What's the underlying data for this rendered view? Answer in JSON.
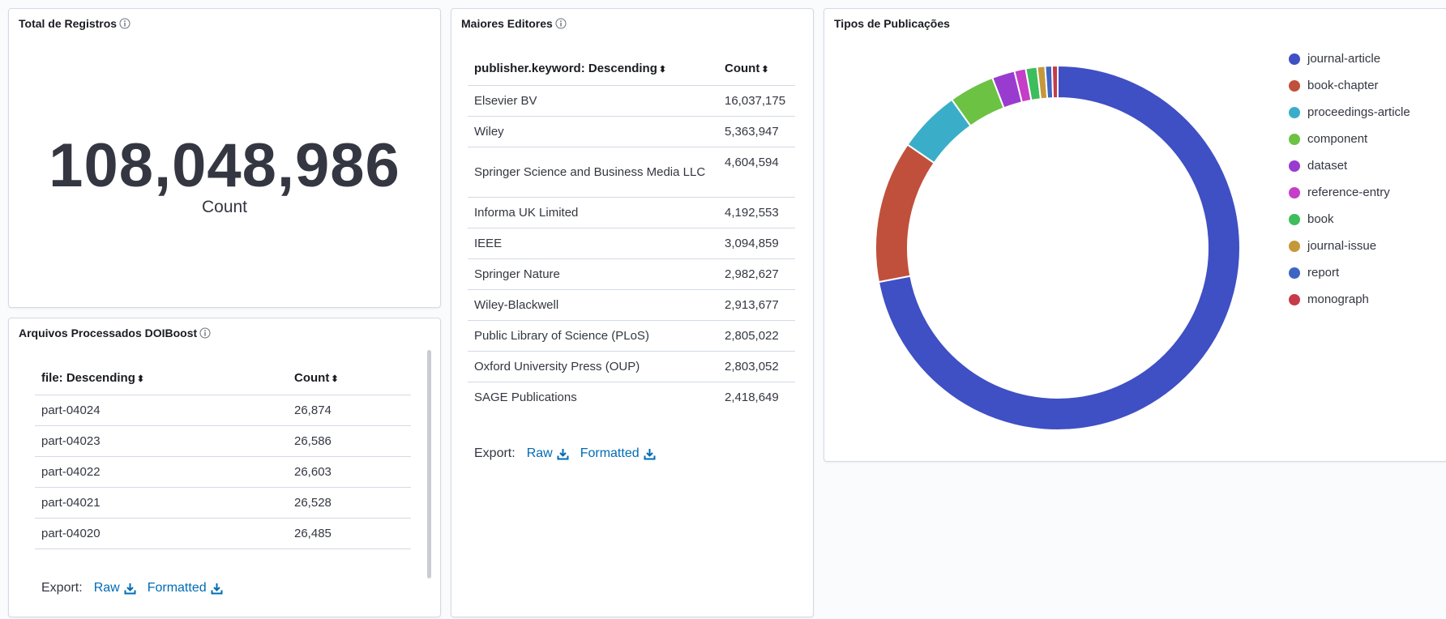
{
  "total_panel": {
    "title": "Total de Registros",
    "value": "108,048,986",
    "label": "Count"
  },
  "files_panel": {
    "title": "Arquivos Processados DOIBoost",
    "headers": {
      "file": "file: Descending",
      "count": "Count"
    },
    "rows": [
      {
        "file": "part-04024",
        "count": "26,874"
      },
      {
        "file": "part-04023",
        "count": "26,586"
      },
      {
        "file": "part-04022",
        "count": "26,603"
      },
      {
        "file": "part-04021",
        "count": "26,528"
      },
      {
        "file": "part-04020",
        "count": "26,485"
      }
    ],
    "export": {
      "label": "Export:",
      "raw": "Raw",
      "formatted": "Formatted"
    }
  },
  "publishers_panel": {
    "title": "Maiores Editores",
    "headers": {
      "publisher": "publisher.keyword: Descending",
      "count": "Count"
    },
    "rows": [
      {
        "name": "Elsevier BV",
        "count": "16,037,175"
      },
      {
        "name": "Wiley",
        "count": "5,363,947"
      },
      {
        "name": "Springer Science and Business Media LLC",
        "count": "4,604,594"
      },
      {
        "name": "Informa UK Limited",
        "count": "4,192,553"
      },
      {
        "name": "IEEE",
        "count": "3,094,859"
      },
      {
        "name": "Springer Nature",
        "count": "2,982,627"
      },
      {
        "name": "Wiley-Blackwell",
        "count": "2,913,677"
      },
      {
        "name": "Public Library of Science (PLoS)",
        "count": "2,805,022"
      },
      {
        "name": "Oxford University Press (OUP)",
        "count": "2,803,052"
      },
      {
        "name": "SAGE Publications",
        "count": "2,418,649"
      }
    ],
    "export": {
      "label": "Export:",
      "raw": "Raw",
      "formatted": "Formatted"
    }
  },
  "types_panel": {
    "title": "Tipos de Publicações"
  },
  "chart_data": {
    "type": "pie",
    "donut": true,
    "legend_position": "right",
    "categories": [
      "journal-article",
      "book-chapter",
      "proceedings-article",
      "component",
      "dataset",
      "reference-entry",
      "book",
      "journal-issue",
      "report",
      "monograph"
    ],
    "values": [
      71.5,
      12.5,
      5.5,
      4.0,
      2.0,
      1.0,
      1.0,
      0.7,
      0.6,
      0.5
    ],
    "colors": [
      "#3f4fc4",
      "#c0503b",
      "#3aaec8",
      "#6cc243",
      "#9a3bd0",
      "#c43ec8",
      "#3dbd5c",
      "#c5983a",
      "#3f65c4",
      "#c53b4a"
    ]
  }
}
